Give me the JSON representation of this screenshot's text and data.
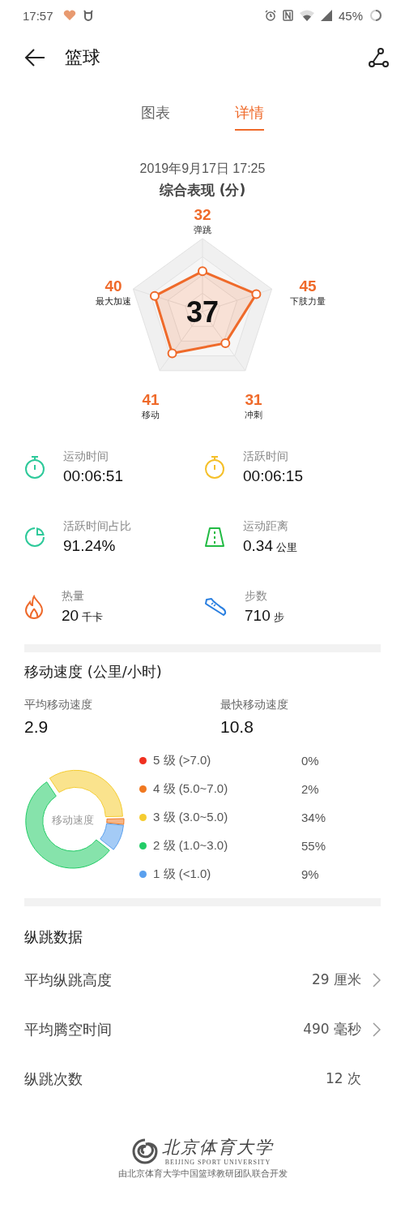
{
  "status_bar": {
    "time": "17:57",
    "battery": "45%"
  },
  "toolbar": {
    "title": "篮球"
  },
  "tabs": [
    {
      "label": "图表",
      "selected": false
    },
    {
      "label": "详情",
      "selected": true
    }
  ],
  "summary": {
    "date": "2019年9月17日 17:25",
    "title": "综合表现 (分)",
    "score": "37",
    "axes": [
      {
        "value": "32",
        "label": "弹跳"
      },
      {
        "value": "45",
        "label": "下肢力量"
      },
      {
        "value": "31",
        "label": "冲刺"
      },
      {
        "value": "41",
        "label": "移动"
      },
      {
        "value": "40",
        "label": "最大加速"
      }
    ]
  },
  "stats": [
    {
      "kind": "stopwatch",
      "color": "#2ec99a",
      "label": "运动时间",
      "value": "00:06:51"
    },
    {
      "kind": "stopwatch",
      "color": "#f5c02a",
      "label": "活跃时间",
      "value": "00:06:15"
    },
    {
      "kind": "pie",
      "color": "#2ec99a",
      "label": "活跃时间占比",
      "value": "91.24%"
    },
    {
      "kind": "road",
      "color": "#22bb44",
      "label": "运动距离",
      "value": "0.34",
      "unit": "公里"
    },
    {
      "kind": "flame",
      "color": "#ee6a2c",
      "label": "热量",
      "value": "20",
      "unit": "千卡"
    },
    {
      "kind": "shoe",
      "color": "#2a7fe0",
      "label": "步数",
      "value": "710",
      "unit": "步"
    }
  ],
  "speed": {
    "title": "移动速度 (公里/小时)",
    "avg_label": "平均移动速度",
    "avg_value": "2.9",
    "max_label": "最快移动速度",
    "max_value": "10.8",
    "chart_center": "移动速度",
    "chart_data": {
      "type": "donut",
      "values": [
        0,
        2,
        34,
        55,
        9
      ]
    },
    "legend": [
      {
        "label": "5 级 (>7.0)",
        "percent": "0%",
        "color": "#f03020"
      },
      {
        "label": "4 级 (5.0~7.0)",
        "percent": "2%",
        "color": "#f07820"
      },
      {
        "label": "3 级 (3.0~5.0)",
        "percent": "34%",
        "color": "#f5cc30"
      },
      {
        "label": "2 级 (1.0~3.0)",
        "percent": "55%",
        "color": "#22cc66"
      },
      {
        "label": "1 级 (<1.0)",
        "percent": "9%",
        "color": "#5aa0ee"
      }
    ]
  },
  "jump": {
    "title": "纵跳数据",
    "rows": [
      {
        "label": "平均纵跳高度",
        "value": "29 厘米",
        "chevron": true
      },
      {
        "label": "平均腾空时间",
        "value": "490 毫秒",
        "chevron": true
      },
      {
        "label": "纵跳次数",
        "value": "12 次",
        "chevron": false
      }
    ]
  },
  "footer": {
    "logo_name": "北京体育大学",
    "logo_english": "BEIJING SPORT UNIVERSITY",
    "credit": "由北京体育大学中国篮球教研团队联合开发"
  }
}
